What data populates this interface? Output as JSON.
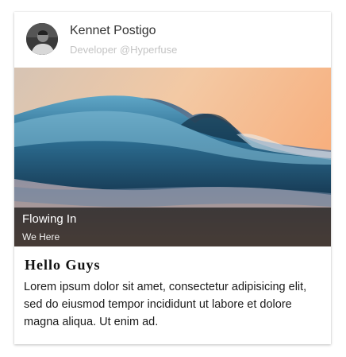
{
  "card": {
    "author_name": "Kennet Postigo",
    "author_subtitle": "Developer @Hyperfuse",
    "avatar_icon": "profile-photo",
    "media": {
      "image_subject": "ocean-wave-at-sunset",
      "caption_title": "Flowing In",
      "caption_subtitle": "We Here"
    },
    "body_title": "Hello Guys",
    "body_text": "Lorem ipsum dolor sit amet, consectetur adipisicing elit, sed do eiusmod tempor incididunt ut labore et dolore magna aliqua. Ut enim ad."
  },
  "colors": {
    "subtitle": "#c4c4c4",
    "overlay": "#141414",
    "wave": "#3a7fa6",
    "sky": "#f6b98c"
  }
}
